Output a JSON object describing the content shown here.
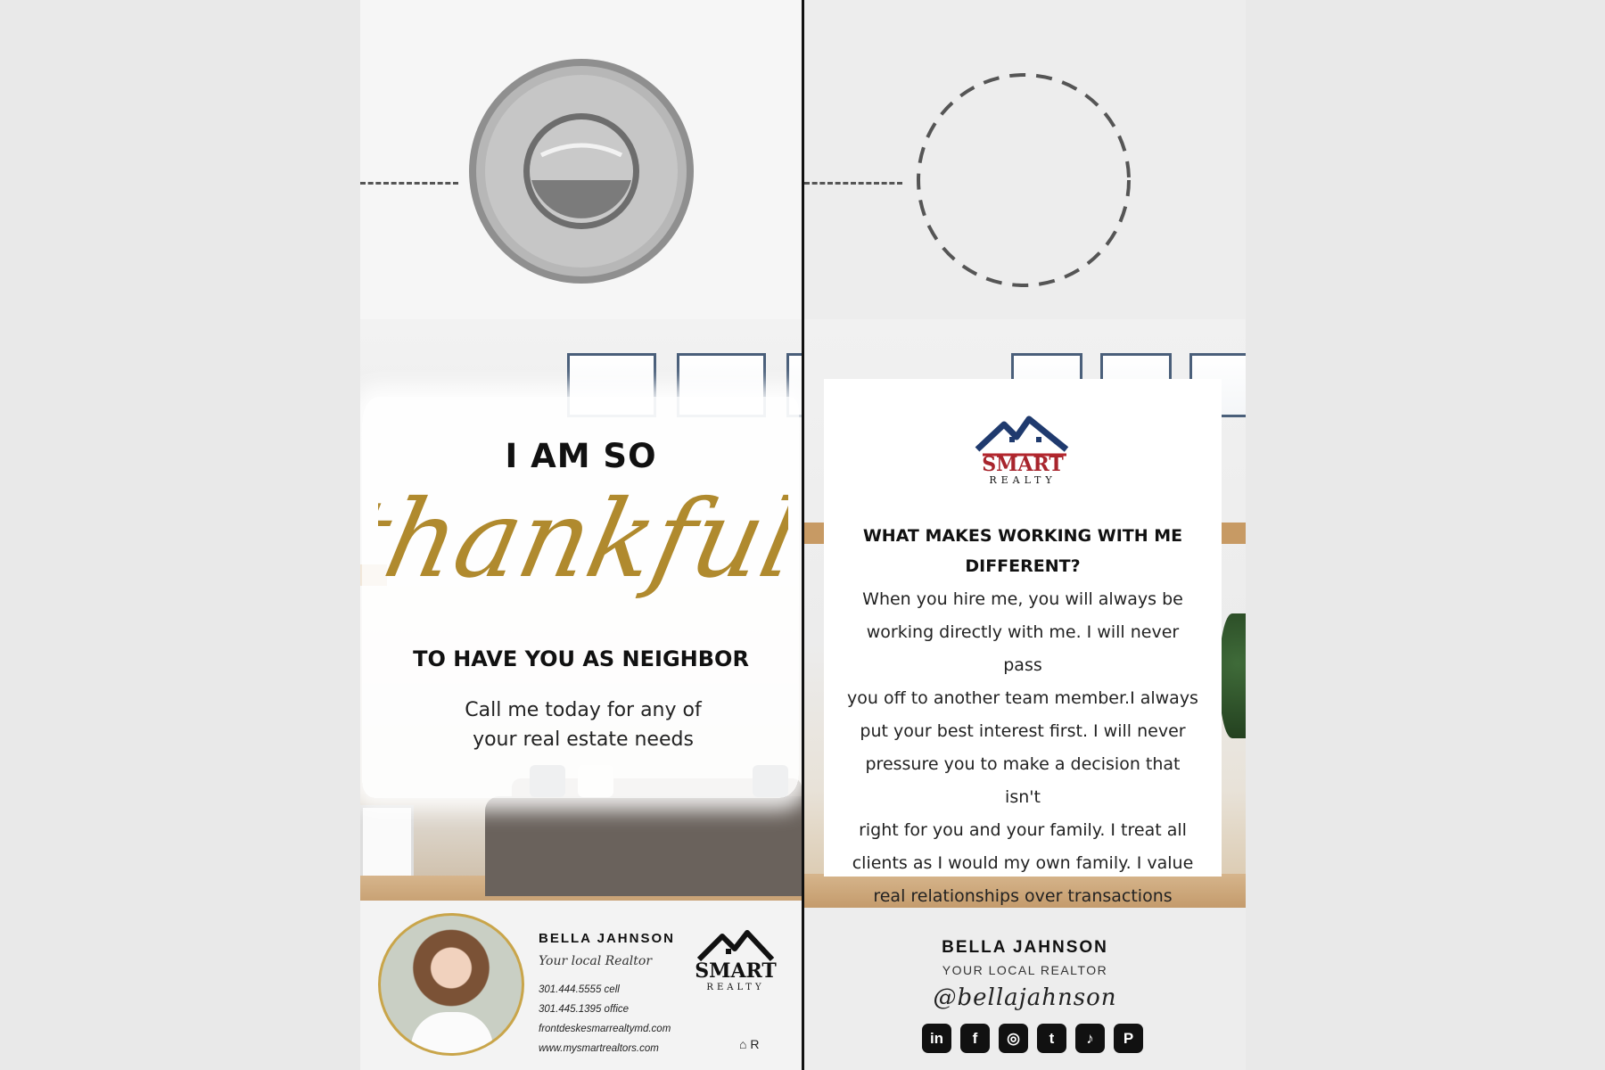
{
  "front": {
    "headline_top": "I AM SO",
    "headline_script": "thankfull",
    "headline_bottom": "TO HAVE YOU AS NEIGHBOR",
    "subtext_line1": "Call me today for any of",
    "subtext_line2": "your real estate needs",
    "agent": {
      "name": "BELLA JAHNSON",
      "title": "Your local Realtor",
      "cell": "301.444.5555 cell",
      "office": "301.445.1395 office",
      "email": "frontdeskesmarrealtymd.com",
      "website": "www.mysmartrealtors.com"
    },
    "badges": "⌂ R"
  },
  "logo": {
    "top": "SMART",
    "bottom": "REALTY",
    "colors": {
      "roof_blue": "#1f3a6e",
      "roof_red": "#b3262d",
      "text_red": "#a8252d"
    }
  },
  "back": {
    "heading": "WHAT MAKES WORKING WITH ME DIFFERENT?",
    "body_lines": [
      "When you hire me, you will always be",
      "working directly with me. I will never pass",
      "you off to another team member.I always",
      "put your best interest first. I will never",
      "pressure you to make a decision that isn't",
      "right for you and your family. I treat all",
      "clients as I would my own family. I value",
      "real relationships over transactions"
    ],
    "agent_name": "BELLA JAHNSON",
    "agent_title": "YOUR LOCAL REALTOR",
    "handle": "@bellajahnson",
    "socials": [
      {
        "icon": "linkedin-icon",
        "glyph": "in"
      },
      {
        "icon": "facebook-icon",
        "glyph": "f"
      },
      {
        "icon": "instagram-icon",
        "glyph": "◎"
      },
      {
        "icon": "twitter-icon",
        "glyph": "t"
      },
      {
        "icon": "tiktok-icon",
        "glyph": "♪"
      },
      {
        "icon": "pinterest-icon",
        "glyph": "P"
      }
    ]
  },
  "colors": {
    "gold": "#b08a2e",
    "dark": "#111111"
  }
}
